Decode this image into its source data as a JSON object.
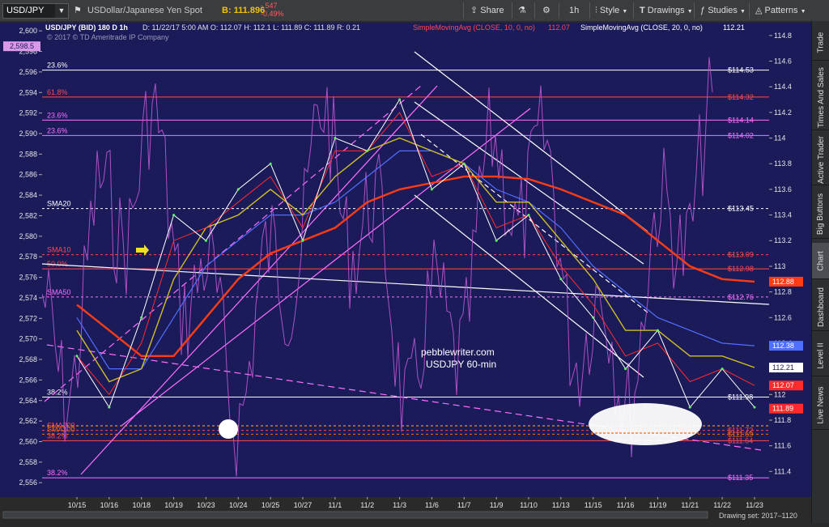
{
  "toolbar": {
    "symbol": "USD/JPY",
    "description": "USDollar/Japanese Yen Spot",
    "bid": "B: 111.896",
    "change": "-.547",
    "change_pct": "-0.49%",
    "share": "Share",
    "interval": "1h",
    "style": "Style",
    "drawings": "Drawings",
    "studies": "Studies",
    "patterns": "Patterns"
  },
  "sidebar": [
    "Trade",
    "Times And Sales",
    "Active Trader",
    "Big Buttons",
    "Chart",
    "Dashboard",
    "Level II",
    "Live News"
  ],
  "sidebar_active": "Chart",
  "header": {
    "title": "USD/JPY (BID) 180 D 1h",
    "ohlc": "D: 11/22/17 5:00 AM   O: 112.07   H: 112.1   L: 111.89   C: 111.89   R: 0.21",
    "sma10_label": "SimpleMovingAvg (CLOSE, 10, 0, no)",
    "sma10_value": "112.07",
    "sma20_label": "SimpleMovingAvg (CLOSE, 20, 0, no)",
    "sma20_value": "112.21",
    "copyright": "© 2017 © TD Ameritrade IP Company"
  },
  "watermark": {
    "line1": "pebblewriter.com",
    "line2": "USDJPY 60-min"
  },
  "footer": {
    "drawing_set": "Drawing set: 2017–1120"
  },
  "colors": {
    "background": "#1c1b5a",
    "sma10": "#ff2a2a",
    "sma20": "#d0c020",
    "sma50": "#4f6fff",
    "sma200": "#ff3c14",
    "price": "#ffffff",
    "indicator": "#c45ad8",
    "fib": "#ff6fff",
    "channel": "#ffffff"
  },
  "chart_data": {
    "type": "line",
    "x": [
      "10/15",
      "10/16",
      "10/18",
      "10/19",
      "10/23",
      "10/24",
      "10/25",
      "10/27",
      "11/1",
      "11/2",
      "11/3",
      "11/6",
      "11/7",
      "11/9",
      "11/10",
      "11/13",
      "11/15",
      "11/16",
      "11/19",
      "11/21",
      "11/22",
      "11/23"
    ],
    "right_axis": {
      "ylim": [
        111.2,
        114.9
      ],
      "ticks": [
        111.4,
        111.6,
        111.8,
        112,
        112.2,
        112.4,
        112.6,
        112.8,
        113,
        113.2,
        113.4,
        113.6,
        113.8,
        114,
        114.2,
        114.4,
        114.6,
        114.8
      ]
    },
    "left_axis": {
      "ylim": [
        2554.6,
        2600.8
      ],
      "ticks": [
        2556,
        2558,
        2560,
        2562,
        2564,
        2566,
        2568,
        2570,
        2572,
        2574,
        2576,
        2578,
        2580,
        2582,
        2584,
        2586,
        2588,
        2590,
        2592,
        2594,
        2596,
        2598,
        2600
      ],
      "marker": "2,598.5"
    },
    "price_levels": [
      {
        "name": "23.6%",
        "value": 114.53,
        "label": "$114.53",
        "color": "#ffffff",
        "style": "solid"
      },
      {
        "name": "61.8%",
        "value": 114.32,
        "label": "$114.32",
        "color": "#ff4a4a",
        "style": "solid"
      },
      {
        "name": "23.6%",
        "value": 114.14,
        "label": "$114.14",
        "color": "#ff6fff",
        "style": "solid"
      },
      {
        "name": "23.6%",
        "value": 114.02,
        "label": "$114.02",
        "color": "#ff6fff",
        "style": "solid"
      },
      {
        "name": "SMA20",
        "value": 113.45,
        "label": "$113.45",
        "color": "#ffffff",
        "style": "dashed"
      },
      {
        "name": "SMA10",
        "value": 113.09,
        "label": "$113.09",
        "color": "#ff4a4a",
        "style": "dashed"
      },
      {
        "name": "50.0%",
        "value": 112.98,
        "label": "$112.98",
        "color": "#ff4a4a",
        "style": "solid"
      },
      {
        "name": "SMA50",
        "value": 112.76,
        "label": "$112.76",
        "color": "#ff6fff",
        "style": "dashed"
      },
      {
        "name": "38.2%",
        "value": 111.98,
        "label": "$111.98",
        "color": "#ffffff",
        "style": "solid"
      },
      {
        "name": "SMA200",
        "value": 111.72,
        "label": "$111.72",
        "color": "#ff4a4a",
        "style": "dashed"
      },
      {
        "name": "SMA100",
        "value": 111.69,
        "label": "$111.69",
        "color": "#ff6a00",
        "style": "dashed"
      },
      {
        "name": "38.2%",
        "value": 111.64,
        "label": "$111.64",
        "color": "#ff4a4a",
        "style": "solid"
      },
      {
        "name": "38.2%",
        "value": 111.35,
        "label": "$111.35",
        "color": "#ff6fff",
        "style": "solid"
      }
    ],
    "last_values": [
      {
        "value": 112.88,
        "label": "112.88",
        "color": "#ff3c14"
      },
      {
        "value": 112.38,
        "label": "112.38",
        "color": "#4f6fff"
      },
      {
        "value": 112.21,
        "label": "112.21",
        "color": "#ffffff"
      },
      {
        "value": 112.07,
        "label": "112.07",
        "color": "#ff2a2a"
      },
      {
        "value": 111.89,
        "label": "111.89",
        "color": "#ff2a2a"
      }
    ],
    "series": [
      {
        "name": "price",
        "y": [
          112.3,
          111.9,
          112.6,
          113.4,
          113.2,
          113.6,
          113.8,
          113.2,
          114.0,
          113.9,
          114.3,
          113.6,
          113.8,
          113.2,
          113.4,
          112.9,
          112.6,
          112.2,
          112.5,
          111.9,
          112.2,
          111.9
        ]
      },
      {
        "name": "SMA 10",
        "y": [
          112.3,
          112.0,
          112.4,
          113.2,
          113.3,
          113.5,
          113.7,
          113.3,
          113.9,
          113.9,
          114.2,
          113.7,
          113.8,
          113.3,
          113.4,
          113.0,
          112.7,
          112.3,
          112.4,
          112.1,
          112.2,
          112.07
        ]
      },
      {
        "name": "SMA 20",
        "y": [
          112.5,
          112.1,
          112.2,
          112.9,
          113.3,
          113.4,
          113.6,
          113.4,
          113.7,
          113.9,
          114.0,
          113.9,
          113.8,
          113.5,
          113.5,
          113.2,
          112.9,
          112.5,
          112.5,
          112.3,
          112.3,
          112.21
        ]
      },
      {
        "name": "SMA 50",
        "y": [
          112.6,
          112.2,
          112.2,
          112.6,
          113.0,
          113.2,
          113.4,
          113.4,
          113.5,
          113.7,
          113.9,
          113.9,
          113.8,
          113.6,
          113.5,
          113.3,
          113.0,
          112.8,
          112.6,
          112.5,
          112.4,
          112.38
        ]
      },
      {
        "name": "SMA 200",
        "y": [
          112.7,
          112.5,
          112.3,
          112.3,
          112.6,
          112.9,
          113.1,
          113.2,
          113.3,
          113.5,
          113.6,
          113.65,
          113.7,
          113.7,
          113.68,
          113.6,
          113.5,
          113.4,
          113.2,
          113.0,
          112.9,
          112.88
        ]
      }
    ]
  }
}
